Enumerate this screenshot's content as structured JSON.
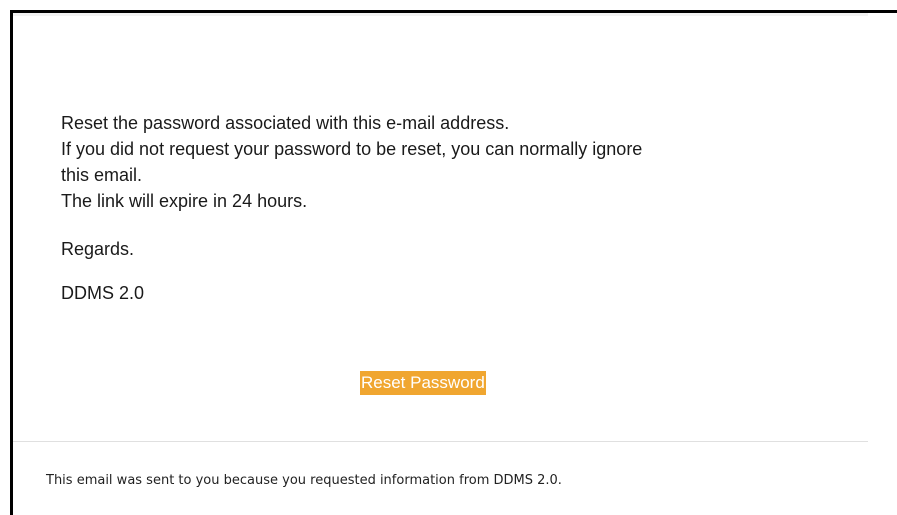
{
  "email": {
    "lines": [
      "Reset the password associated with this e-mail address.",
      "If you did not request your password to be reset, you can normally ignore",
      "this email.",
      "The link will expire in 24 hours."
    ],
    "closing": "Regards.",
    "signature": "DDMS 2.0",
    "button_label": "Reset Password",
    "footer": "This email was sent to you because you requested information from DDMS 2.0."
  },
  "colors": {
    "button_bg": "#f0a630",
    "button_text": "#ffffff",
    "frame_border": "#000000"
  }
}
